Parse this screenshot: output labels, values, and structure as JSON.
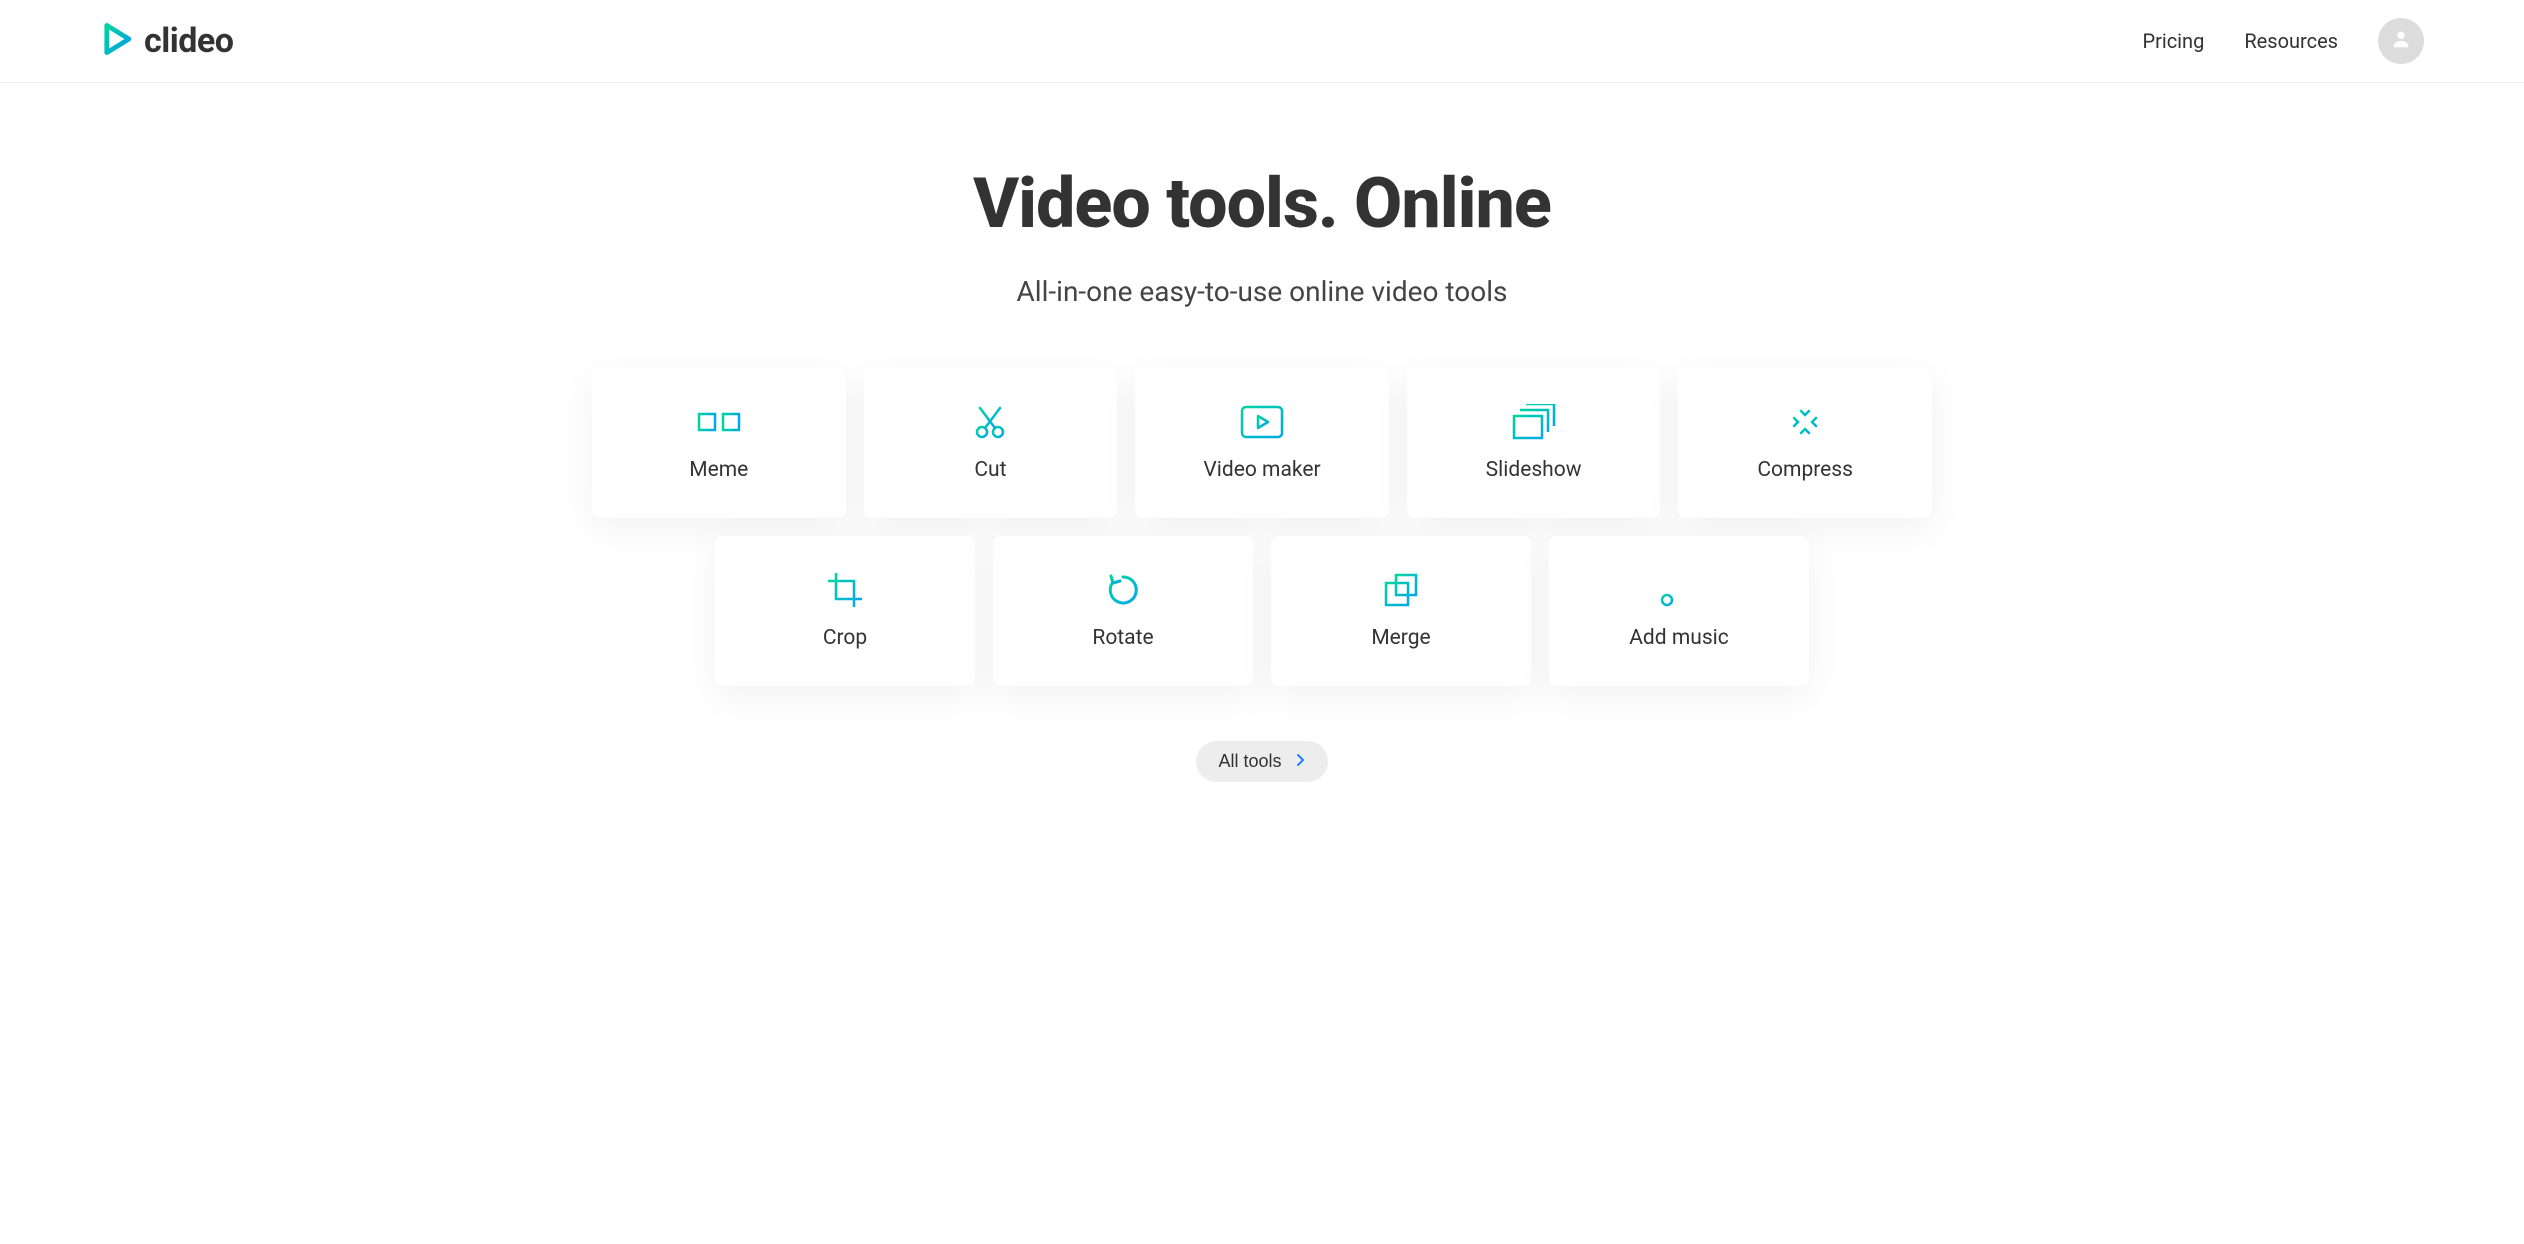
{
  "brand": {
    "name": "clideo"
  },
  "nav": {
    "pricing": "Pricing",
    "resources": "Resources"
  },
  "hero": {
    "title": "Video tools. Online",
    "subtitle": "All-in-one easy-to-use online video tools"
  },
  "tools": {
    "meme": "Meme",
    "cut": "Cut",
    "video_maker": "Video maker",
    "slideshow": "Slideshow",
    "compress": "Compress",
    "crop": "Crop",
    "rotate": "Rotate",
    "merge": "Merge",
    "add_music": "Add music"
  },
  "footer": {
    "all_tools": "All tools"
  },
  "colors": {
    "accent_teal": "#00c4b3",
    "accent_blue": "#1e7fff"
  }
}
